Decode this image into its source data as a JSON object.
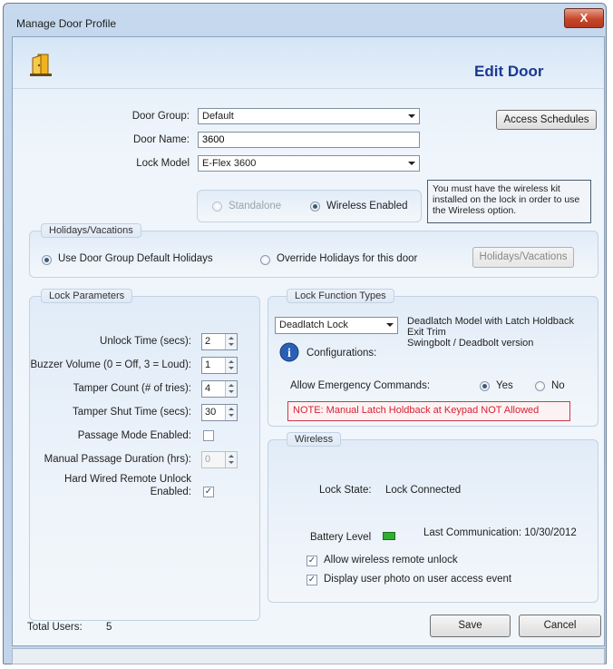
{
  "window": {
    "title": "Manage Door Profile",
    "close_glyph": "X"
  },
  "header": {
    "title": "Edit Door",
    "icon": "door-icon"
  },
  "form": {
    "door_group": {
      "label": "Door Group:",
      "value": "Default"
    },
    "door_name": {
      "label": "Door Name:",
      "value": "3600"
    },
    "lock_model": {
      "label": "Lock Model",
      "value": "E-Flex 3600"
    },
    "access_schedules_button": "Access Schedules",
    "mode": {
      "standalone": "Standalone",
      "wireless": "Wireless Enabled",
      "selected": "wireless"
    },
    "wireless_note": "You must have the wireless kit installed on the lock in order to use the Wireless option."
  },
  "holidays": {
    "title": "Holidays/Vacations",
    "use_group": "Use Door Group Default Holidays",
    "override": "Override Holidays for this door",
    "button": "Holidays/Vacations",
    "selected": "use_group"
  },
  "lock_parameters": {
    "title": "Lock Parameters",
    "unlock_time": {
      "label": "Unlock Time (secs):",
      "value": "2"
    },
    "buzzer_volume": {
      "label": "Buzzer Volume (0 = Off, 3 = Loud):",
      "value": "1"
    },
    "tamper_count": {
      "label": "Tamper Count (# of tries):",
      "value": "4"
    },
    "tamper_shut_time": {
      "label": "Tamper Shut Time (secs):",
      "value": "30"
    },
    "passage_mode": {
      "label": "Passage Mode Enabled:",
      "checked": false
    },
    "manual_passage_duration": {
      "label": "Manual Passage Duration (hrs):",
      "value": "0"
    },
    "hard_wired_label_1": "Hard Wired Remote Unlock",
    "hard_wired_label_2": "Enabled:",
    "hard_wired_checked": true
  },
  "lock_function": {
    "title": "Lock Function Types",
    "type_value": "Deadlatch Lock",
    "description_1": "Deadlatch Model with Latch Holdback",
    "description_2": "Exit Trim",
    "description_3": "Swingbolt / Deadbolt version",
    "configurations_label": "Configurations:",
    "info_glyph": "i",
    "emergency_label": "Allow Emergency Commands:",
    "yes": "Yes",
    "no": "No",
    "emergency_selected": "yes",
    "note": "NOTE: Manual Latch Holdback at Keypad NOT Allowed"
  },
  "wireless": {
    "title": "Wireless",
    "lock_state_label": "Lock State:",
    "lock_state_value": "Lock Connected",
    "battery_label": "Battery Level",
    "battery_color": "#2fae2f",
    "last_comm": "Last Communication: 10/30/2012",
    "allow_remote_unlock": "Allow wireless remote unlock",
    "display_photo": "Display user photo on user access event",
    "allow_remote_checked": true,
    "display_photo_checked": true
  },
  "footer": {
    "total_users_label": "Total Users:",
    "total_users_value": "5",
    "save": "Save",
    "cancel": "Cancel"
  },
  "check_glyph": "✓",
  "colors": {
    "title_accent": "#1b3a8f",
    "warning": "#d42235",
    "close_button": "#c7462b"
  }
}
